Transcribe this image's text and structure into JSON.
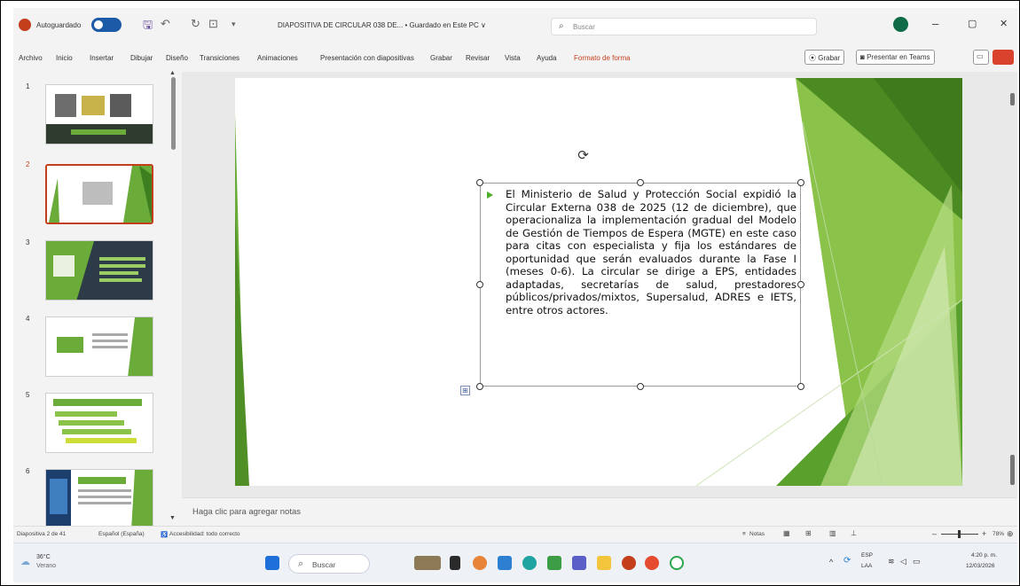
{
  "titlebar": {
    "autosave_label": "Autoguardado",
    "doc_title": "DIAPOSITIVA DE CIRCULAR 038 DE... • Guardado en Este PC ∨",
    "search_placeholder": "Buscar",
    "minimize": "–",
    "restore": "▢",
    "close": "✕"
  },
  "ribbon": {
    "tabs": [
      "Archivo",
      "Inicio",
      "Insertar",
      "Dibujar",
      "Diseño",
      "Transiciones",
      "Animaciones",
      "Presentación con diapositivas",
      "Grabar",
      "Revisar",
      "Vista",
      "Ayuda",
      "Formato de forma"
    ],
    "record_label": "Grabar",
    "teams_label": "Presentar en Teams",
    "accent_color": "#c43e1c"
  },
  "thumbnails": {
    "numbers": [
      "1",
      "2",
      "3",
      "4",
      "5",
      "6"
    ],
    "active_index": 2
  },
  "slide": {
    "bullet_text": "El Ministerio de Salud y Protección Social expidió la Circular Externa 038 de 2025 (12 de diciembre), que operacionaliza la implementación gradual del Modelo de Gestión de Tiempos de Espera (MGTE) en este caso para citas con especialista y fija los estándares de oportunidad que serán evaluados durante la Fase I (meses 0-6). La circular se dirige a EPS, entidades adaptadas, secretarías de salud, prestadores públicos/privados/mixtos, Supersalud, ADRES e IETS, entre otros actores.",
    "theme_green": "#5aa02c"
  },
  "notes": {
    "placeholder": "Haga clic para agregar notas"
  },
  "status": {
    "slide_counter": "Diapositiva 2 de 41",
    "language": "Español (España)",
    "accessibility": "Accesibilidad: todo correcto",
    "notes_button": "Notas",
    "zoom": "78%"
  },
  "taskbar": {
    "weather_temp": "36°C",
    "weather_desc": "Verano",
    "search_label": "Buscar",
    "lang_top": "ESP",
    "lang_bottom": "LAA",
    "time": "4:20 p. m.",
    "date": "12/03/2026"
  }
}
